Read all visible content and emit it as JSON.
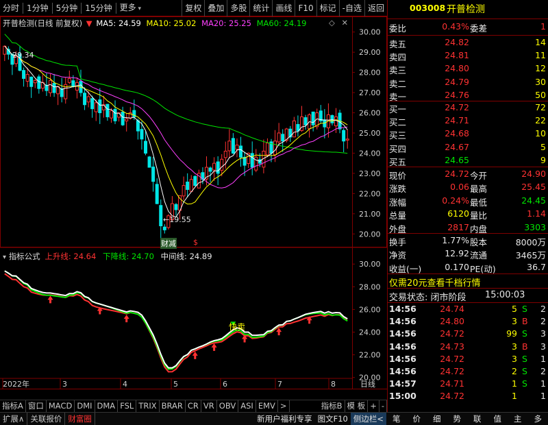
{
  "toolbar": {
    "left": [
      "分时",
      "1分钟",
      "5分钟",
      "15分钟",
      "更多"
    ],
    "right": [
      "复权",
      "叠加",
      "多股",
      "统计",
      "画线",
      "F10",
      "标记",
      "-自选",
      "返回"
    ]
  },
  "stock": {
    "code": "003008",
    "name": "开普检测"
  },
  "main_chart": {
    "title": "开普检测(日线 前复权)",
    "ma": [
      {
        "label": "MA5: 24.59",
        "color": "#ffffff"
      },
      {
        "label": "MA10: 25.02",
        "color": "#ffff00"
      },
      {
        "label": "MA20: 25.25",
        "color": "#ff40ff"
      },
      {
        "label": "MA60: 24.19",
        "color": "#00e600"
      }
    ],
    "high_mark": "29.34",
    "low_mark": "19.55",
    "event_label": "财减",
    "event_icon": "$"
  },
  "sub_chart": {
    "title": "指标公式",
    "items": [
      {
        "label": "上升线: 24.64",
        "color": "#ff3232"
      },
      {
        "label": "下降线: 24.70",
        "color": "#00e600"
      },
      {
        "label": "中间线: 24.89",
        "color": "#e8e8e8"
      }
    ],
    "signal_label": "快卖"
  },
  "chart_data": [
    {
      "type": "candlestick",
      "title": "开普检测(日线 前复权)",
      "ylim": [
        19.5,
        30.5
      ],
      "yticks": [
        30.0,
        29.0,
        28.0,
        27.0,
        26.0,
        25.0,
        24.0,
        23.0,
        22.0,
        21.0,
        20.0
      ],
      "annotations": [
        {
          "text": "29.34",
          "y": 29.34
        },
        {
          "text": "19.55",
          "y": 19.55
        }
      ],
      "close": [
        29.3,
        28.9,
        28.4,
        28.8,
        28.1,
        27.7,
        27.9,
        27.3,
        27.6,
        27.2,
        27.5,
        27.1,
        27.6,
        27.0,
        27.3,
        26.8,
        27.4,
        27.7,
        27.3,
        27.5,
        27.0,
        26.4,
        26.8,
        26.2,
        26.5,
        26.0,
        26.4,
        25.8,
        26.1,
        25.6,
        26.0,
        25.4,
        25.7,
        26.0,
        25.8,
        25.1,
        24.7,
        24.0,
        23.3,
        22.6,
        21.5,
        20.4,
        20.2,
        20.9,
        21.5,
        21.2,
        21.9,
        22.4,
        22.2,
        22.7,
        22.4,
        23.0,
        22.7,
        23.3,
        23.1,
        23.5,
        23.0,
        23.7,
        24.1,
        24.6,
        24.0,
        24.4,
        23.8,
        23.4,
        24.0,
        23.3,
        23.8,
        23.5,
        24.1,
        24.5,
        24.0,
        24.6,
        25.0,
        24.6,
        25.2,
        24.8,
        25.6,
        25.1,
        25.8,
        25.4,
        25.9,
        25.4,
        26.0,
        25.6,
        25.3,
        25.9,
        25.5,
        25.8,
        25.2,
        24.6,
        24.7
      ],
      "ma_series": [
        {
          "name": "MA5"
        },
        {
          "name": "MA10"
        },
        {
          "name": "MA20"
        },
        {
          "name": "MA60"
        }
      ]
    },
    {
      "type": "line",
      "title": "指标公式",
      "ylim": [
        19.8,
        30.8
      ],
      "yticks": [
        30.0,
        28.0,
        26.0,
        24.0,
        22.0,
        20.0
      ],
      "series": [
        {
          "name": "上升线"
        },
        {
          "name": "下降线"
        },
        {
          "name": "中间线"
        }
      ],
      "x_labels": [
        "2022年",
        "3",
        "4",
        "5",
        "6",
        "7",
        "8"
      ],
      "x_label_right": "日线"
    }
  ],
  "quote": {
    "weibi": {
      "label": "委比",
      "value": "0.43%"
    },
    "weicha": {
      "label": "委差",
      "value": "1"
    },
    "asks": [
      {
        "label": "卖五",
        "price": "24.82",
        "vol": "14"
      },
      {
        "label": "卖四",
        "price": "24.81",
        "vol": "11"
      },
      {
        "label": "卖三",
        "price": "24.80",
        "vol": "12"
      },
      {
        "label": "卖二",
        "price": "24.79",
        "vol": "30"
      },
      {
        "label": "卖一",
        "price": "24.76",
        "vol": "50"
      }
    ],
    "bids": [
      {
        "label": "买一",
        "price": "24.72",
        "vol": "72"
      },
      {
        "label": "买二",
        "price": "24.71",
        "vol": "22"
      },
      {
        "label": "买三",
        "price": "24.68",
        "vol": "10"
      },
      {
        "label": "买四",
        "price": "24.67",
        "vol": "5"
      },
      {
        "label": "买五",
        "price": "24.65",
        "vol": "9"
      }
    ],
    "stats": [
      [
        {
          "label": "现价",
          "value": "24.72",
          "color": "red"
        },
        {
          "label": "今开",
          "value": "24.90",
          "color": "red"
        }
      ],
      [
        {
          "label": "涨跌",
          "value": "0.06",
          "color": "red"
        },
        {
          "label": "最高",
          "value": "25.45",
          "color": "red"
        }
      ],
      [
        {
          "label": "涨幅",
          "value": "0.24%",
          "color": "red"
        },
        {
          "label": "最低",
          "value": "24.45",
          "color": "grn"
        }
      ],
      [
        {
          "label": "总量",
          "value": "6120",
          "color": "yel"
        },
        {
          "label": "量比",
          "value": "1.14",
          "color": "red"
        }
      ],
      [
        {
          "label": "外盘",
          "value": "2817",
          "color": "red"
        },
        {
          "label": "内盘",
          "value": "3303",
          "color": "grn"
        }
      ]
    ],
    "fin": [
      [
        {
          "label": "换手",
          "value": "1.77%"
        },
        {
          "label": "股本",
          "value": "8000万"
        }
      ],
      [
        {
          "label": "净资",
          "value": "12.92"
        },
        {
          "label": "流通",
          "value": "3465万"
        }
      ],
      [
        {
          "label": "收益(一)",
          "value": "0.170"
        },
        {
          "label": "PE(动)",
          "value": "36.7"
        }
      ]
    ],
    "promo": "仅需20元查看千档行情",
    "trade_status_label": "交易状态: 闭市阶段",
    "trade_status_time": "15:00:03",
    "ticks": [
      {
        "time": "14:56",
        "price": "24.74",
        "vol": "5",
        "bs": "S",
        "n": "2"
      },
      {
        "time": "14:56",
        "price": "24.80",
        "vol": "3",
        "bs": "B",
        "n": "2"
      },
      {
        "time": "14:56",
        "price": "24.72",
        "vol": "99",
        "bs": "S",
        "n": "3"
      },
      {
        "time": "14:56",
        "price": "24.73",
        "vol": "3",
        "bs": "B",
        "n": "3"
      },
      {
        "time": "14:56",
        "price": "24.72",
        "vol": "3",
        "bs": "S",
        "n": "1"
      },
      {
        "time": "14:56",
        "price": "24.72",
        "vol": "2",
        "bs": "S",
        "n": "2"
      },
      {
        "time": "14:57",
        "price": "24.71",
        "vol": "1",
        "bs": "S",
        "n": "1"
      },
      {
        "time": "15:00",
        "price": "24.72",
        "vol": "1",
        "bs": "",
        "n": "1"
      }
    ]
  },
  "bottom_tabs": [
    "指标A",
    "窗口",
    "MACD",
    "DMI",
    "DMA",
    "FSL",
    "TRIX",
    "BRAR",
    "CR",
    "VR",
    "OBV",
    "ASI",
    "EMV",
    ">",
    "指标B",
    "模 板",
    "+",
    "-"
  ],
  "status_bar": {
    "left": [
      "扩展∧",
      "关联报价",
      "财富圈"
    ],
    "mid": [
      "新用户福利专享",
      "图文F10",
      "侧边栏<"
    ],
    "right": [
      "笔",
      "价",
      "细",
      "势",
      "联",
      "值",
      "主",
      "多"
    ]
  }
}
